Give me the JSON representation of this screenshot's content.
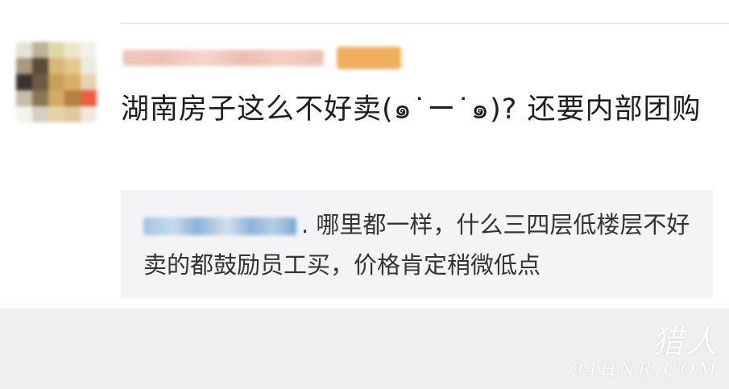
{
  "comment": {
    "text": "湖南房子这么不好卖(๑˙ー˙๑)? 还要内部团购"
  },
  "reply": {
    "text": ". 哪里都一样，什么三四层低楼层不好卖的都鼓励员工买，价格肯定稍微低点"
  },
  "watermark": {
    "logo": "猎人",
    "url": "94HNR.COM"
  },
  "colors": {
    "comment_text": "#1e1e1e",
    "reply_text": "#333333",
    "reply_background": "#f4f4f6",
    "badge": "#f0b060",
    "footer_background": "#efeff1"
  }
}
